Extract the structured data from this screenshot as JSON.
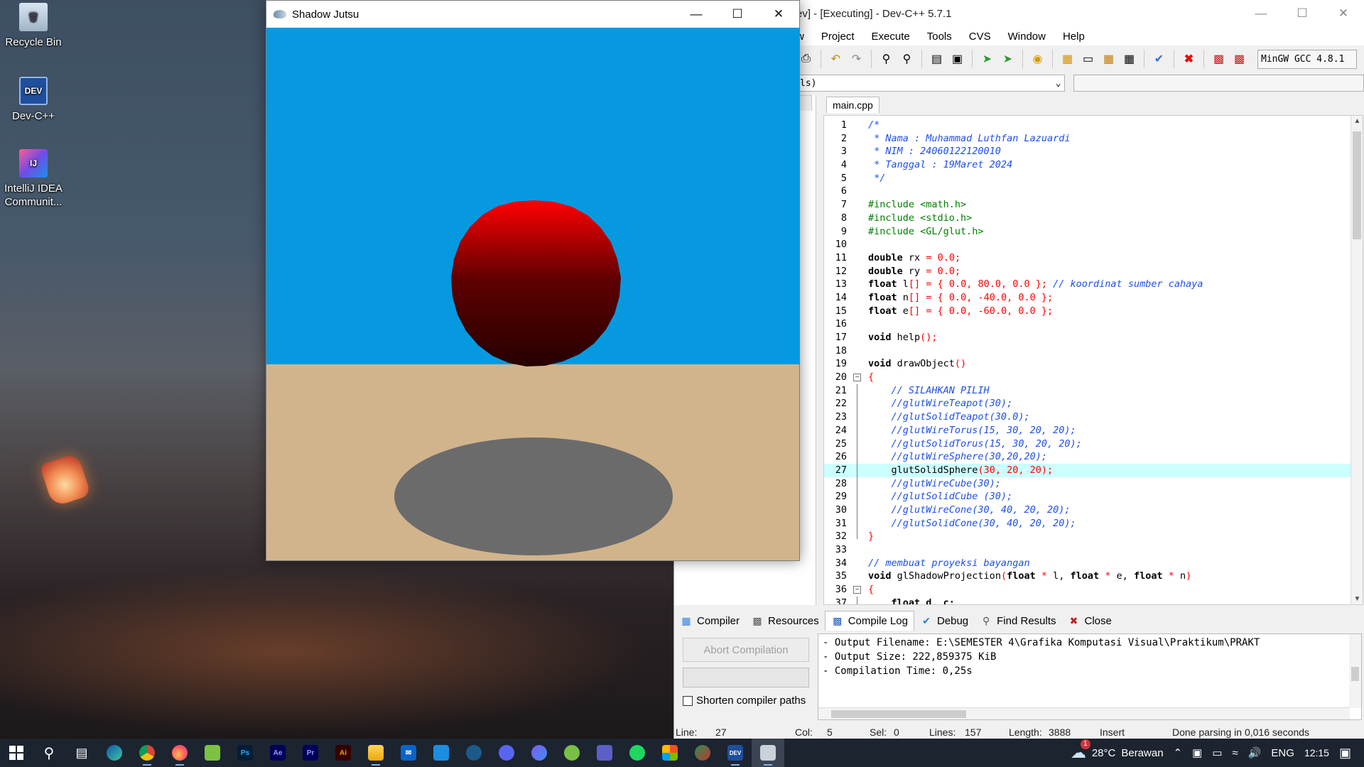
{
  "desktop": {
    "icons": [
      {
        "label": "Recycle Bin",
        "glyph": "🗑"
      },
      {
        "label": "Dev-C++",
        "glyph": "DEV"
      },
      {
        "label": "IntelliJ IDEA Communit...",
        "glyph": "IJ"
      }
    ]
  },
  "gl_window": {
    "title": "Shadow Jutsu",
    "colors": {
      "sky": "#0699e0",
      "ground": "#d2b48c",
      "sphere": "#ff0000",
      "shadow": "#6b6b6b"
    }
  },
  "devcpp": {
    "title": "ev] - [Executing] - Dev-C++ 5.7.1",
    "menu": [
      "w",
      "Project",
      "Execute",
      "Tools",
      "CVS",
      "Window",
      "Help"
    ],
    "compiler_select": "MinGW GCC 4.8.1",
    "class_combo": "ls)",
    "editor_tab": "main.cpp",
    "code_lines": [
      [
        {
          "t": "/*",
          "c": "c-com"
        }
      ],
      [
        {
          "t": " * Nama : Muhammad Luthfan Lazuardi",
          "c": "c-com"
        }
      ],
      [
        {
          "t": " * NIM : 24060122120010",
          "c": "c-com"
        }
      ],
      [
        {
          "t": " * Tanggal : 19Maret 2024",
          "c": "c-com"
        }
      ],
      [
        {
          "t": " */",
          "c": "c-com"
        }
      ],
      [
        {
          "t": "",
          "c": ""
        }
      ],
      [
        {
          "t": "#include <math.h>",
          "c": "c-pre"
        }
      ],
      [
        {
          "t": "#include <stdio.h>",
          "c": "c-pre"
        }
      ],
      [
        {
          "t": "#include <GL/glut.h>",
          "c": "c-pre"
        }
      ],
      [
        {
          "t": "",
          "c": ""
        }
      ],
      [
        {
          "t": "double",
          "c": "c-kw"
        },
        {
          "t": " rx ",
          "c": ""
        },
        {
          "t": "=",
          "c": "c-sym"
        },
        {
          "t": " 0.0",
          "c": "c-num"
        },
        {
          "t": ";",
          "c": "c-sym"
        }
      ],
      [
        {
          "t": "double",
          "c": "c-kw"
        },
        {
          "t": " ry ",
          "c": ""
        },
        {
          "t": "=",
          "c": "c-sym"
        },
        {
          "t": " 0.0",
          "c": "c-num"
        },
        {
          "t": ";",
          "c": "c-sym"
        }
      ],
      [
        {
          "t": "float",
          "c": "c-kw"
        },
        {
          "t": " l",
          "c": ""
        },
        {
          "t": "[] = { ",
          "c": "c-sym"
        },
        {
          "t": "0.0",
          "c": "c-num"
        },
        {
          "t": ", ",
          "c": "c-sym"
        },
        {
          "t": "80.0",
          "c": "c-num"
        },
        {
          "t": ", ",
          "c": "c-sym"
        },
        {
          "t": "0.0",
          "c": "c-num"
        },
        {
          "t": " }; ",
          "c": "c-sym"
        },
        {
          "t": "// koordinat sumber cahaya",
          "c": "c-com"
        }
      ],
      [
        {
          "t": "float",
          "c": "c-kw"
        },
        {
          "t": " n",
          "c": ""
        },
        {
          "t": "[] = { ",
          "c": "c-sym"
        },
        {
          "t": "0.0",
          "c": "c-num"
        },
        {
          "t": ", ",
          "c": "c-sym"
        },
        {
          "t": "-40.0",
          "c": "c-num"
        },
        {
          "t": ", ",
          "c": "c-sym"
        },
        {
          "t": "0.0",
          "c": "c-num"
        },
        {
          "t": " };",
          "c": "c-sym"
        }
      ],
      [
        {
          "t": "float",
          "c": "c-kw"
        },
        {
          "t": " e",
          "c": ""
        },
        {
          "t": "[] = { ",
          "c": "c-sym"
        },
        {
          "t": "0.0",
          "c": "c-num"
        },
        {
          "t": ", ",
          "c": "c-sym"
        },
        {
          "t": "-60.0",
          "c": "c-num"
        },
        {
          "t": ", ",
          "c": "c-sym"
        },
        {
          "t": "0.0",
          "c": "c-num"
        },
        {
          "t": " };",
          "c": "c-sym"
        }
      ],
      [
        {
          "t": "",
          "c": ""
        }
      ],
      [
        {
          "t": "void",
          "c": "c-kw"
        },
        {
          "t": " help",
          "c": ""
        },
        {
          "t": "();",
          "c": "c-sym"
        }
      ],
      [
        {
          "t": "",
          "c": ""
        }
      ],
      [
        {
          "t": "void",
          "c": "c-kw"
        },
        {
          "t": " drawObject",
          "c": ""
        },
        {
          "t": "()",
          "c": "c-sym"
        }
      ],
      [
        {
          "t": "{",
          "c": "c-sym"
        }
      ],
      [
        {
          "t": "    // SILAHKAN PILIH",
          "c": "c-com"
        }
      ],
      [
        {
          "t": "    //glutWireTeapot(30);",
          "c": "c-com"
        }
      ],
      [
        {
          "t": "    //glutSolidTeapot(30.0);",
          "c": "c-com"
        }
      ],
      [
        {
          "t": "    //glutWireTorus(15, 30, 20, 20);",
          "c": "c-com"
        }
      ],
      [
        {
          "t": "    //glutSolidTorus(15, 30, 20, 20);",
          "c": "c-com"
        }
      ],
      [
        {
          "t": "    //glutWireSphere(30,20,20);",
          "c": "c-com"
        }
      ],
      [
        {
          "t": "    glutSolidSphere",
          "c": ""
        },
        {
          "t": "(",
          "c": "c-sym"
        },
        {
          "t": "30",
          "c": "c-num"
        },
        {
          "t": ", ",
          "c": "c-sym"
        },
        {
          "t": "20",
          "c": "c-num"
        },
        {
          "t": ", ",
          "c": "c-sym"
        },
        {
          "t": "20",
          "c": "c-num"
        },
        {
          "t": ");",
          "c": "c-sym"
        }
      ],
      [
        {
          "t": "    //glutWireCube(30);",
          "c": "c-com"
        }
      ],
      [
        {
          "t": "    //glutSolidCube (30);",
          "c": "c-com"
        }
      ],
      [
        {
          "t": "    //glutWireCone(30, 40, 20, 20);",
          "c": "c-com"
        }
      ],
      [
        {
          "t": "    //glutSolidCone(30, 40, 20, 20);",
          "c": "c-com"
        }
      ],
      [
        {
          "t": "}",
          "c": "c-sym"
        }
      ],
      [
        {
          "t": "",
          "c": ""
        }
      ],
      [
        {
          "t": "// membuat proyeksi bayangan",
          "c": "c-com"
        }
      ],
      [
        {
          "t": "void",
          "c": "c-kw"
        },
        {
          "t": " glShadowProjection",
          "c": ""
        },
        {
          "t": "(",
          "c": "c-sym"
        },
        {
          "t": "float",
          "c": "c-kw"
        },
        {
          "t": " * ",
          "c": "c-sym"
        },
        {
          "t": "l, ",
          "c": ""
        },
        {
          "t": "float",
          "c": "c-kw"
        },
        {
          "t": " * ",
          "c": "c-sym"
        },
        {
          "t": "e, ",
          "c": ""
        },
        {
          "t": "float",
          "c": "c-kw"
        },
        {
          "t": " * ",
          "c": "c-sym"
        },
        {
          "t": "n",
          "c": ""
        },
        {
          "t": ")",
          "c": "c-sym"
        }
      ],
      [
        {
          "t": "{",
          "c": "c-sym"
        }
      ],
      [
        {
          "t": "    float d, c;",
          "c": "c-kw"
        }
      ]
    ],
    "active_line": 27,
    "bottom_tabs": [
      "Compiler",
      "Resources",
      "Compile Log",
      "Debug",
      "Find Results",
      "Close"
    ],
    "active_bottom_tab": "Compile Log",
    "abort_label": "Abort Compilation",
    "progress": 0,
    "shorten_label": "Shorten compiler paths",
    "log_lines": [
      "- Output Filename: E:\\SEMESTER 4\\Grafika Komputasi Visual\\Praktikum\\PRAKT",
      "- Output Size: 222,859375 KiB",
      "- Compilation Time: 0,25s"
    ],
    "status": {
      "line_label": "Line:",
      "line": "27",
      "col_label": "Col:",
      "col": "5",
      "sel_label": "Sel:",
      "sel": "0",
      "lines_label": "Lines:",
      "lines": "157",
      "length_label": "Length:",
      "length": "3888",
      "mode": "Insert",
      "message": "Done parsing in 0,016 seconds"
    }
  },
  "taskbar": {
    "apps": [
      "start",
      "search",
      "task-view",
      "edge",
      "chrome",
      "firefox",
      "notepad-plus",
      "Ps",
      "Ae",
      "Pr",
      "Ai",
      "file-explorer",
      "mail",
      "vscode",
      "steam",
      "discord",
      "clipchamp",
      "utorrent",
      "teams",
      "spotify",
      "office",
      "feather",
      "devcpp",
      "glut-window"
    ],
    "weather_temp": "28°C",
    "weather_text": "Berawan",
    "weather_badge": "1",
    "language": "ENG",
    "time": "12:15"
  }
}
